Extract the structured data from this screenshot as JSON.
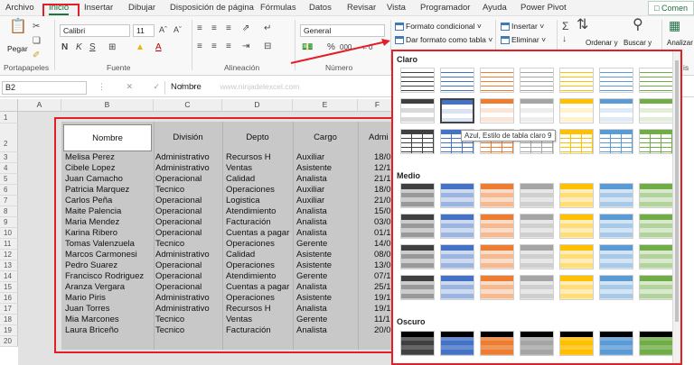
{
  "colors": {
    "accent": "#217346",
    "highlight_red": "#e41e26",
    "table_gray": "#c8c8c8"
  },
  "menu": {
    "tabs": [
      "Archivo",
      "Inicio",
      "Insertar",
      "Dibujar",
      "Disposición de página",
      "Fórmulas",
      "Datos",
      "Revisar",
      "Vista",
      "Programador",
      "Ayuda",
      "Power Pivot"
    ],
    "active": "Inicio",
    "comments_label": "Comen"
  },
  "ribbon": {
    "paste_label": "Pegar",
    "font_name": "Calibri",
    "font_size": "11",
    "number_format": "General",
    "cond_format_label": "Formato condicional",
    "table_format_label": "Dar formato como tabla",
    "insert_label": "Insertar",
    "delete_label": "Eliminar",
    "sort_label": "Ordenar y",
    "find_label": "Buscar y",
    "analyze_label": "Analizar",
    "groups": {
      "clipboard": "Portapapeles",
      "font": "Fuente",
      "alignment": "Alineación",
      "number": "Número",
      "analysis": "is"
    },
    "bold": "N",
    "italic": "K",
    "underline": "S",
    "percent": "%",
    "thousands": "000"
  },
  "formula_bar": {
    "name_box": "B2",
    "value": "Nombre",
    "watermark": "www.ninjadelexcel.com"
  },
  "sheet": {
    "columns": [
      "A",
      "B",
      "C",
      "D",
      "E",
      "F"
    ],
    "rows": [
      "1",
      "2",
      "3",
      "4",
      "5",
      "6",
      "7",
      "8",
      "9",
      "10",
      "11",
      "12",
      "13",
      "14",
      "15",
      "16",
      "17",
      "18",
      "19",
      "20"
    ],
    "headers": [
      "Nombre",
      "División",
      "Depto",
      "Cargo",
      "Admi"
    ],
    "data": [
      [
        "Melisa Perez",
        "Administrativo",
        "Recursos H",
        "Auxiliar",
        "18/0"
      ],
      [
        "Cibele Lopez",
        "Administrativo",
        "Ventas",
        "Asistente",
        "12/1"
      ],
      [
        "Juan Camacho",
        "Operacional",
        "Calidad",
        "Analista",
        "21/1"
      ],
      [
        "Patricia Marquez",
        "Tecnico",
        "Operaciones",
        "Auxiliar",
        "18/0"
      ],
      [
        "Carlos Peña",
        "Operacional",
        "Logistica",
        "Auxiliar",
        "21/0"
      ],
      [
        "Maite Palencia",
        "Operacional",
        "Atendimiento",
        "Analista",
        "15/0"
      ],
      [
        "Maria Mendez",
        "Operacional",
        "Facturación",
        "Analista",
        "03/0"
      ],
      [
        "Karina Ribero",
        "Operacional",
        "Cuentas a pagar",
        "Analista",
        "01/1"
      ],
      [
        "Tomas Valenzuela",
        "Tecnico",
        "Operaciones",
        "Gerente",
        "14/0"
      ],
      [
        "Marcos Carmonesi",
        "Administrativo",
        "Calidad",
        "Asistente",
        "08/0"
      ],
      [
        "Pedro Suarez",
        "Operacional",
        "Operaciones",
        "Asistente",
        "13/0"
      ],
      [
        "Francisco Rodriguez",
        "Operacional",
        "Atendimiento",
        "Gerente",
        "07/1"
      ],
      [
        "Aranza Vergara",
        "Operacional",
        "Cuentas a pagar",
        "Analista",
        "25/1"
      ],
      [
        "Mario Piris",
        "Administrativo",
        "Operaciones",
        "Asistente",
        "19/1"
      ],
      [
        "Juan Torres",
        "Administrativo",
        "Recursos H",
        "Analista",
        "19/1"
      ],
      [
        "Mia Marcones",
        "Tecnico",
        "Ventas",
        "Gerente",
        "11/1"
      ],
      [
        "Laura Briceño",
        "Tecnico",
        "Facturación",
        "Analista",
        "20/0"
      ]
    ]
  },
  "gallery": {
    "sections": [
      "Claro",
      "Medio",
      "Oscuro"
    ],
    "tooltip": "Azul, Estilo de tabla claro 9",
    "palette": [
      "#404040",
      "#4472c4",
      "#ed7d31",
      "#a5a5a5",
      "#ffc000",
      "#5b9bd5",
      "#70ad47"
    ]
  }
}
